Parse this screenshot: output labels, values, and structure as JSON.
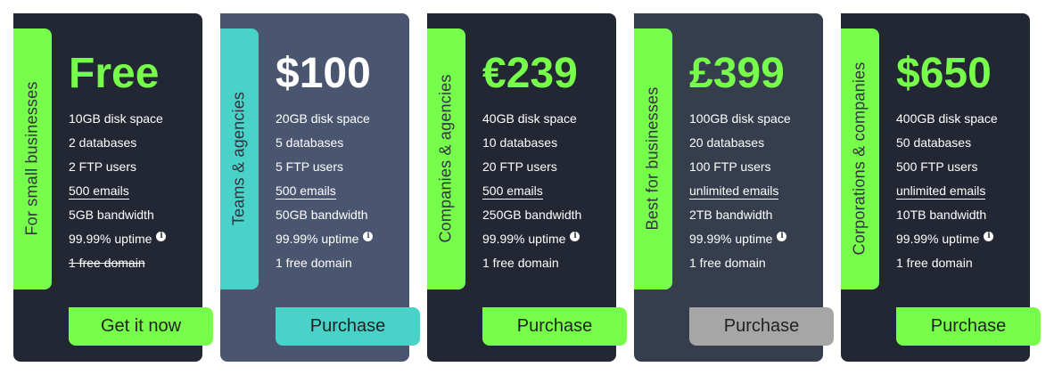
{
  "colors": {
    "dark_card": "#232733",
    "blue_card": "#4a5670",
    "slate_card": "#363d4d",
    "green_accent": "#77fe4a",
    "teal_accent": "#48d2c8",
    "gray_button": "#a6a6a6"
  },
  "plans": [
    {
      "tag": "For small businesses",
      "price": "Free",
      "features": [
        "10GB disk space",
        "2 databases",
        "2 FTP users",
        "500 emails",
        "5GB bandwidth",
        "99.99% uptime",
        "1 free domain"
      ],
      "button": "Get it now",
      "info_icon": "info-icon"
    },
    {
      "tag": "Teams & agencies",
      "price": "$100",
      "features": [
        "20GB disk space",
        "5 databases",
        "5 FTP users",
        "500 emails",
        "50GB bandwidth",
        "99.99% uptime",
        "1 free domain"
      ],
      "button": "Purchase",
      "info_icon": "info-icon"
    },
    {
      "tag": "Companies & agencies",
      "price": "€239",
      "features": [
        "40GB disk space",
        "10 databases",
        "20 FTP users",
        "500 emails",
        "250GB bandwidth",
        "99.99% uptime",
        "1 free domain"
      ],
      "button": "Purchase",
      "info_icon": "info-icon"
    },
    {
      "tag": "Best for businesses",
      "price": "£399",
      "features": [
        "100GB disk space",
        "20 databases",
        "100 FTP users",
        "unlimited emails",
        "2TB bandwidth",
        "99.99% uptime",
        "1 free domain"
      ],
      "button": "Purchase",
      "info_icon": "info-icon"
    },
    {
      "tag": "Corporations & companies",
      "price": "$650",
      "features": [
        "400GB disk space",
        "50 databases",
        "500 FTP users",
        "unlimited emails",
        "10TB bandwidth",
        "99.99% uptime",
        "1 free domain"
      ],
      "button": "Purchase",
      "info_icon": "info-icon"
    }
  ]
}
